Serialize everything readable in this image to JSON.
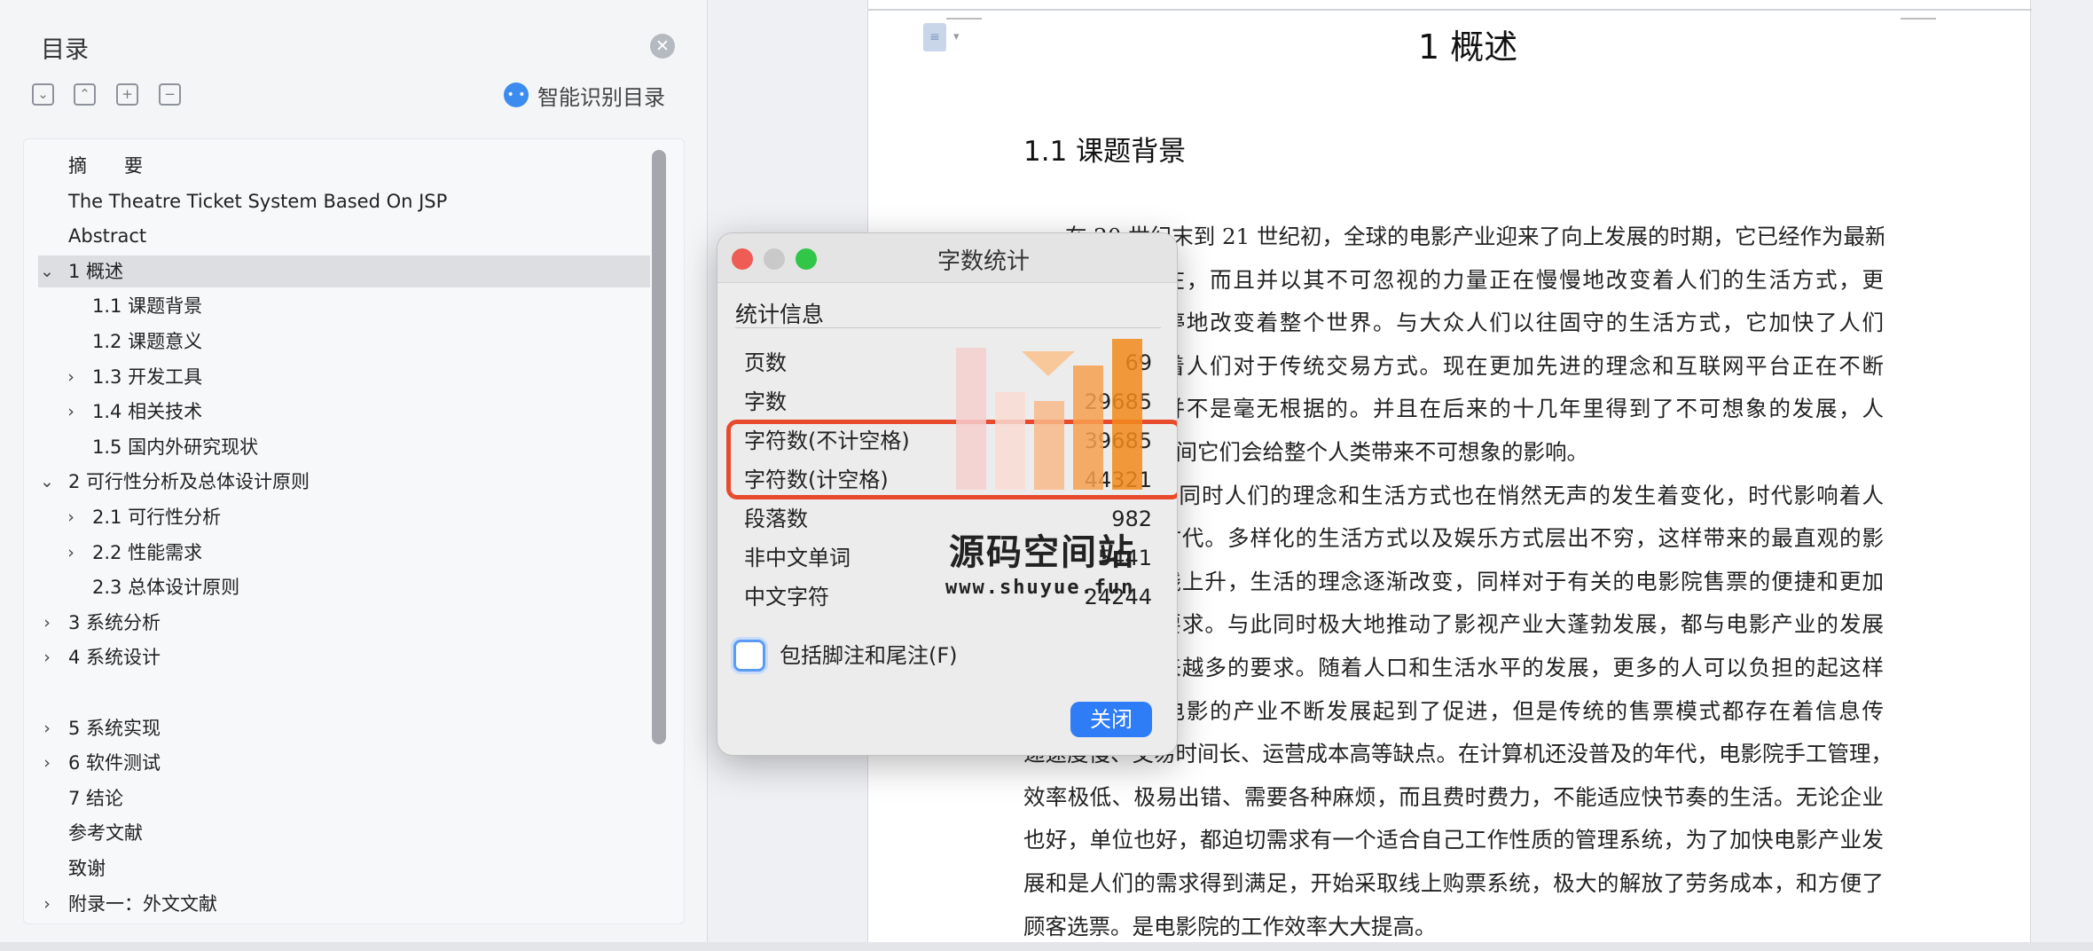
{
  "toc": {
    "title": "目录",
    "close_icon": "close-icon",
    "toolbar_icons": [
      "collapse-all-icon",
      "expand-all-icon",
      "add-heading-icon",
      "remove-heading-icon"
    ],
    "smart_recognize_label": "智能识别目录",
    "items": [
      {
        "label": "摘　　要",
        "level": 0,
        "chevron": "",
        "active": false
      },
      {
        "label": "The Theatre Ticket System Based On JSP",
        "level": 0,
        "chevron": "",
        "active": false
      },
      {
        "label": "Abstract",
        "level": 0,
        "chevron": "",
        "active": false
      },
      {
        "label": "1 概述",
        "level": 0,
        "chevron": "down",
        "active": true
      },
      {
        "label": "1.1 课题背景",
        "level": 1,
        "chevron": "",
        "active": false
      },
      {
        "label": "1.2 课题意义",
        "level": 1,
        "chevron": "",
        "active": false
      },
      {
        "label": "1.3 开发工具",
        "level": 1,
        "chevron": "right",
        "active": false
      },
      {
        "label": "1.4 相关技术",
        "level": 1,
        "chevron": "right",
        "active": false
      },
      {
        "label": "1.5 国内外研究现状",
        "level": 1,
        "chevron": "",
        "active": false
      },
      {
        "label": "2 可行性分析及总体设计原则",
        "level": 0,
        "chevron": "down",
        "active": false
      },
      {
        "label": "2.1 可行性分析",
        "level": 1,
        "chevron": "right",
        "active": false
      },
      {
        "label": "2.2 性能需求",
        "level": 1,
        "chevron": "right",
        "active": false
      },
      {
        "label": "2.3 总体设计原则",
        "level": 1,
        "chevron": "",
        "active": false
      },
      {
        "label": "3  系统分析",
        "level": 0,
        "chevron": "right",
        "active": false
      },
      {
        "label": "4 系统设计",
        "level": 0,
        "chevron": "right",
        "active": false
      },
      {
        "label": "",
        "level": 0,
        "chevron": "",
        "active": false
      },
      {
        "label": "5 系统实现",
        "level": 0,
        "chevron": "right",
        "active": false
      },
      {
        "label": "6 软件测试",
        "level": 0,
        "chevron": "right",
        "active": false
      },
      {
        "label": "7 结论",
        "level": 0,
        "chevron": "",
        "active": false
      },
      {
        "label": "参考文献",
        "level": 0,
        "chevron": "",
        "active": false
      },
      {
        "label": "致谢",
        "level": 0,
        "chevron": "",
        "active": false
      },
      {
        "label": "附录一：外文文献",
        "level": 0,
        "chevron": "right",
        "active": false
      }
    ]
  },
  "document": {
    "heading1": "1 概述",
    "heading2": "1.1 课题背景",
    "lines": [
      {
        "text": "在 20 世纪末到 21 世纪初，全球的电影产业迎来了向上发展的时期，它已经作为最新",
        "indent": true,
        "last": false
      },
      {
        "text": "的媒体形式存在，而且并以其不可忽视的力量正在慢慢地改变着人们的生活方式，更",
        "indent": false,
        "last": false
      },
      {
        "text": "大程度上在不停地改变着整个世界。与大众人们以往固守的生活方式，它加快了人们",
        "indent": false,
        "last": false
      },
      {
        "text": "的节奏，影响着人们对于传统交易方式。现在更加先进的理念和互联网平台正在不断",
        "indent": false,
        "last": false
      },
      {
        "text": "的出现，产生并不是毫无根据的。并且在后来的十几年里得到了不可想象的发展，人",
        "indent": false,
        "last": false
      },
      {
        "text": "们相信在几十年间它们会给整个人类带来不可想象的影响。",
        "indent": false,
        "last": true
      },
      {
        "text": "与此同时，同时人们的理念和生活方式也在悄然无声的发生着变化，时代影响着人",
        "indent": true,
        "last": false
      },
      {
        "text": "们，人们改变时代。多样化的生活方式以及娱乐方式层出不穷，这样带来的最直观的影",
        "indent": false,
        "last": false
      },
      {
        "text": "响就是消费直线上升，生活的理念逐渐改变，同样对于有关的电影院售票的便捷和更加",
        "indent": false,
        "last": false
      },
      {
        "text": "人性化提出了要求。与此同时极大地推动了影视产业大蓬勃发展，都与电影产业的发展",
        "indent": false,
        "last": false
      },
      {
        "text": "，人们提出越来越多的要求。随着人口和生活水平的发展，更多的人可以负担的起这样",
        "indent": false,
        "last": false
      },
      {
        "text": "的消费，对于电影的产业不断发展起到了促进，但是传统的售票模式都存在着信息传",
        "indent": false,
        "last": false
      },
      {
        "text": "递速度慢、交易时间长、运营成本高等缺点。在计算机还没普及的年代，电影院手工管理，",
        "indent": false,
        "last": false
      },
      {
        "text": "效率极低、极易出错、需要各种麻烦，而且费时费力，不能适应快节奏的生活。无论企业",
        "indent": false,
        "last": false
      },
      {
        "text": "也好，单位也好，都迫切需求有一个适合自己工作性质的管理系统，为了加快电影产业发",
        "indent": false,
        "last": false
      },
      {
        "text": "展和是人们的需求得到满足，开始采取线上购票系统，极大的解放了劳务成本，和方便了",
        "indent": false,
        "last": false
      },
      {
        "text": "顾客选票。是电影院的工作效率大大提高。",
        "indent": false,
        "last": true
      }
    ]
  },
  "dialog": {
    "title": "字数统计",
    "section": "统计信息",
    "stats": [
      {
        "label": "页数",
        "value": "69"
      },
      {
        "label": "字数",
        "value": "29685"
      },
      {
        "label": "字符数(不计空格)",
        "value": "39685"
      },
      {
        "label": "字符数(计空格)",
        "value": "44321"
      },
      {
        "label": "段落数",
        "value": "982"
      },
      {
        "label": "非中文单词",
        "value": "5441"
      },
      {
        "label": "中文字符",
        "value": "24244"
      }
    ],
    "checkbox_label": "包括脚注和尾注(F)",
    "checkbox_checked": false,
    "close_label": "关闭",
    "traffic_lights": {
      "close": "#ee5c55",
      "minimize": "#c9c9c9",
      "zoom": "#32c648"
    }
  },
  "watermark": {
    "title": "源码空间站",
    "url": "www.shuyue.fun",
    "bar_colors": [
      "#f6cfcf",
      "#f9dcd4",
      "#f8b98a",
      "#f6a04f",
      "#f28a1c"
    ]
  },
  "accent": {
    "highlight": "#e84a2c",
    "button": "#2e7cf6"
  }
}
